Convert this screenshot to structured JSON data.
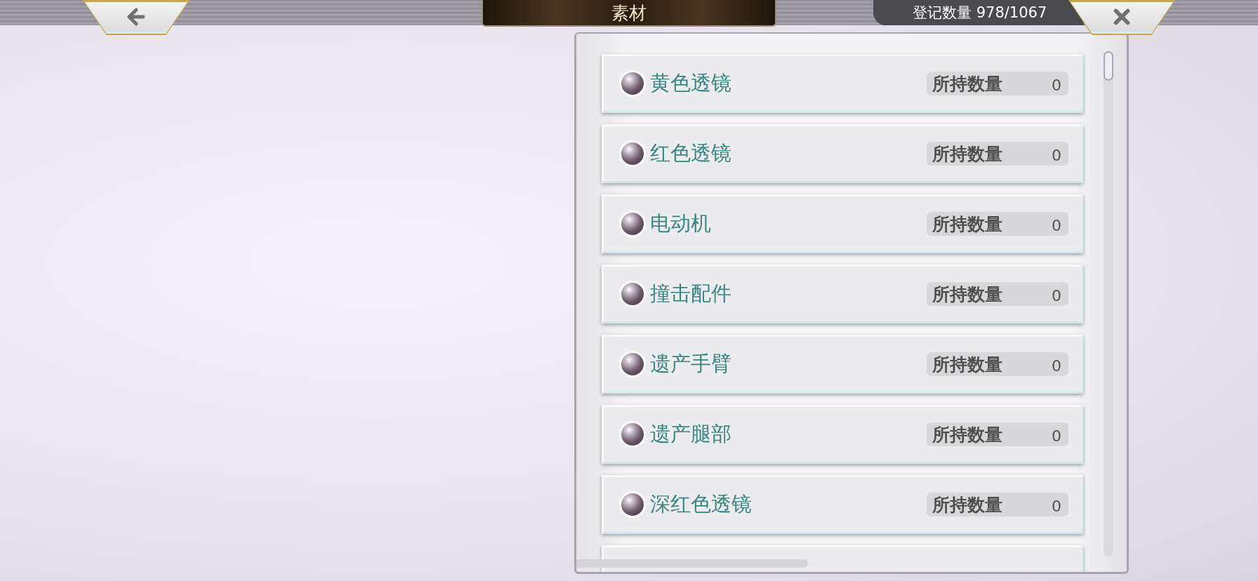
{
  "header": {
    "title": "素材",
    "counter": "登记数量 978/1067"
  },
  "items": [
    {
      "name": "黄色透镜",
      "owned_label": "所持数量",
      "owned_value": "0"
    },
    {
      "name": "红色透镜",
      "owned_label": "所持数量",
      "owned_value": "0"
    },
    {
      "name": "电动机",
      "owned_label": "所持数量",
      "owned_value": "0"
    },
    {
      "name": "撞击配件",
      "owned_label": "所持数量",
      "owned_value": "0"
    },
    {
      "name": "遗产手臂",
      "owned_label": "所持数量",
      "owned_value": "0"
    },
    {
      "name": "遗产腿部",
      "owned_label": "所持数量",
      "owned_value": "0"
    },
    {
      "name": "深红色透镜",
      "owned_label": "所持数量",
      "owned_value": "0"
    }
  ]
}
